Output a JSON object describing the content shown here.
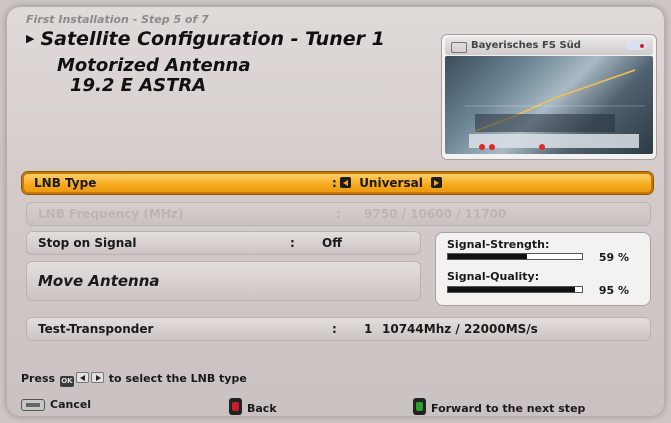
{
  "header": {
    "step": "First Installation - Step 5 of 7",
    "title": "Satellite Configuration - Tuner 1",
    "subtitle1": "Motorized Antenna",
    "subtitle2": "19.2 E ASTRA"
  },
  "preview": {
    "channel": "Bayerisches FS Süd"
  },
  "settings": {
    "lnb": {
      "label": "LNB Type",
      "sep": ":",
      "value": "Universal"
    },
    "lnb_freq": {
      "label": "LNB Frequency (MHz)",
      "sep": ":",
      "value": "9750 / 10600 / 11700"
    },
    "stop_on_signal": {
      "label": "Stop on Signal",
      "sep": ":",
      "value": "Off"
    },
    "move_antenna": {
      "label": "Move Antenna"
    },
    "test_transponder": {
      "label": "Test-Transponder",
      "sep": ":",
      "index": "1",
      "value": "10744Mhz / 22000MS/s"
    }
  },
  "signal": {
    "strength_label": "Signal-Strength:",
    "strength_pct": "59 %",
    "strength_value": 0.59,
    "quality_label": "Signal-Quality:",
    "quality_pct": "95 %",
    "quality_value": 0.95
  },
  "hint": {
    "prefix": "Press",
    "ok_key": "OK",
    "suffix": "to select the LNB type"
  },
  "footer": {
    "cancel": "Cancel",
    "back": "Back",
    "forward": "Forward to the next step"
  },
  "colors": {
    "highlight": "#f5a81a",
    "back_button": "#c8202a",
    "forward_button": "#2aa12a"
  }
}
